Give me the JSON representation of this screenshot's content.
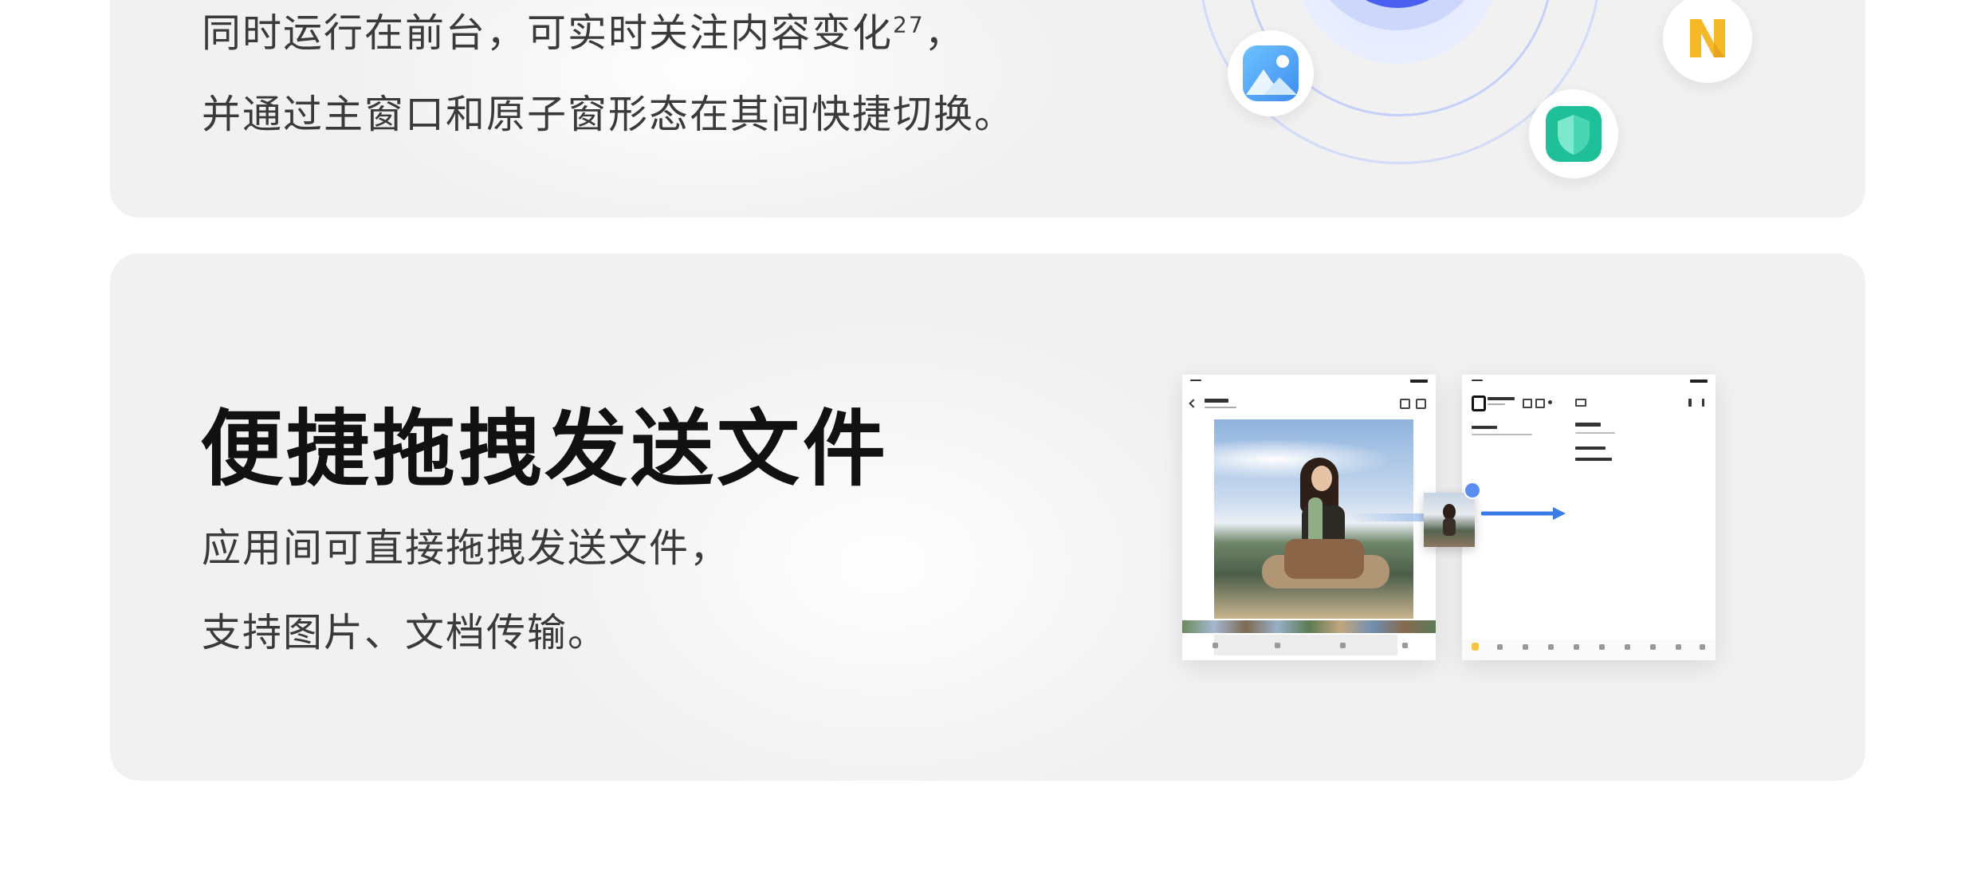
{
  "top_card": {
    "line1": "同时运行在前台，可实时关注内容变化",
    "line1_sup": "27",
    "line1_end": "，",
    "line2": "并通过主窗口和原子窗形态在其间快捷切换。"
  },
  "bottom_card": {
    "title": "便捷拖拽发送文件",
    "line1": "应用间可直接拖拽发送文件，",
    "line2": "支持图片、文档传输。"
  },
  "icons": {
    "gallery": "gallery-icon",
    "notes": "notes-icon",
    "security": "security-shield-icon",
    "photo": "photo-thumbnail-icon",
    "arrow": "drag-arrow-icon"
  },
  "colors": {
    "card_bg": "#f1f1f2",
    "orbit_blue": "#4a63f0",
    "notes_yellow": "#f5b826",
    "shield_green": "#22c7a1",
    "arrow_blue": "#3b7be8"
  }
}
